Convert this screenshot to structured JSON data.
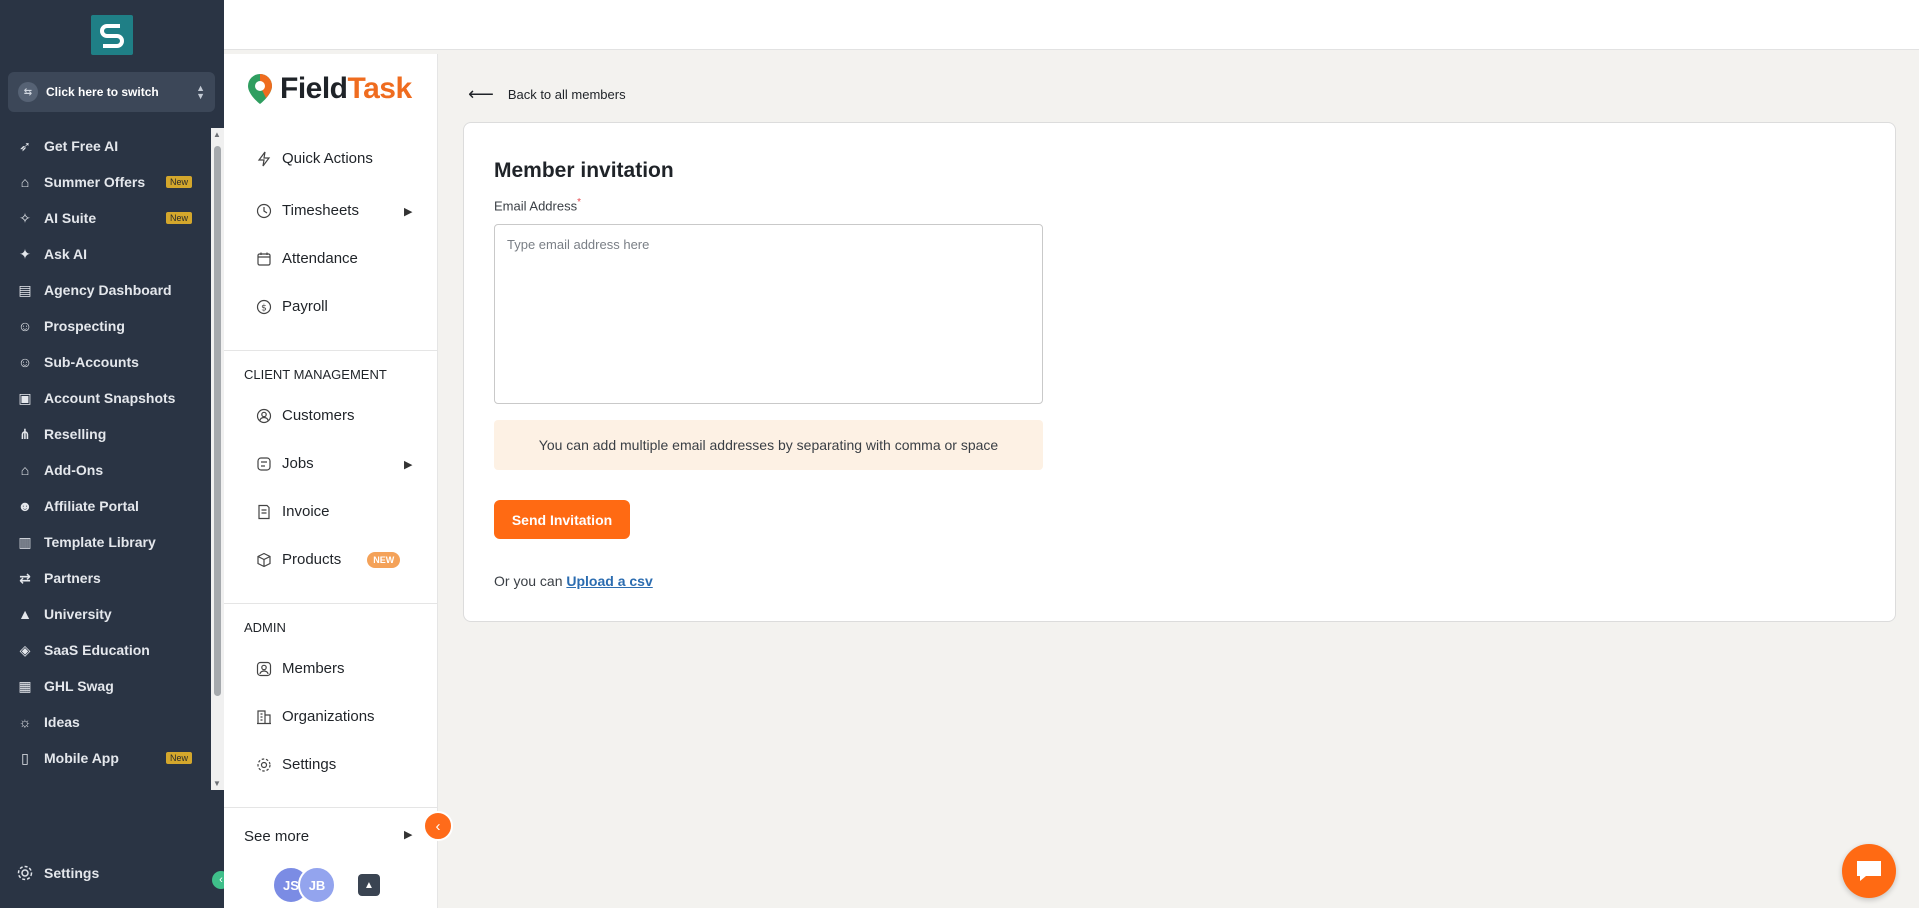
{
  "sidebar": {
    "switcher_label": "Click here to switch",
    "items": [
      {
        "label": "Get Free AI",
        "icon": "rocket-icon",
        "badge": ""
      },
      {
        "label": "Summer Offers",
        "icon": "gift-icon",
        "badge": "New"
      },
      {
        "label": "AI Suite",
        "icon": "sparkle-icon",
        "badge": "New"
      },
      {
        "label": "Ask AI",
        "icon": "stars-icon",
        "badge": ""
      },
      {
        "label": "Agency Dashboard",
        "icon": "dashboard-icon",
        "badge": ""
      },
      {
        "label": "Prospecting",
        "icon": "user-search-icon",
        "badge": ""
      },
      {
        "label": "Sub-Accounts",
        "icon": "user-icon",
        "badge": ""
      },
      {
        "label": "Account Snapshots",
        "icon": "snapshot-icon",
        "badge": ""
      },
      {
        "label": "Reselling",
        "icon": "network-icon",
        "badge": ""
      },
      {
        "label": "Add-Ons",
        "icon": "bag-icon",
        "badge": ""
      },
      {
        "label": "Affiliate Portal",
        "icon": "users-icon",
        "badge": ""
      },
      {
        "label": "Template Library",
        "icon": "library-icon",
        "badge": ""
      },
      {
        "label": "Partners",
        "icon": "handshake-icon",
        "badge": ""
      },
      {
        "label": "University",
        "icon": "graduation-icon",
        "badge": ""
      },
      {
        "label": "SaaS Education",
        "icon": "cube-icon",
        "badge": ""
      },
      {
        "label": "GHL Swag",
        "icon": "store-icon",
        "badge": ""
      },
      {
        "label": "Ideas",
        "icon": "bulb-icon",
        "badge": ""
      },
      {
        "label": "Mobile App",
        "icon": "phone-icon",
        "badge": "New"
      }
    ],
    "settings_label": "Settings"
  },
  "panel": {
    "brand_part1": "Field",
    "brand_part2": "Task",
    "quick_actions": "Quick Actions",
    "timesheets": "Timesheets",
    "attendance": "Attendance",
    "payroll": "Payroll",
    "client_management_heading": "CLIENT MANAGEMENT",
    "customers": "Customers",
    "jobs": "Jobs",
    "invoice": "Invoice",
    "products": "Products",
    "products_badge": "NEW",
    "admin_heading": "ADMIN",
    "members": "Members",
    "organizations": "Organizations",
    "settings": "Settings",
    "see_more": "See more",
    "avatar1": "JS",
    "avatar2": "JB"
  },
  "main": {
    "back_link": "Back to all members",
    "title": "Member invitation",
    "email_label": "Email Address",
    "required_mark": "*",
    "email_placeholder": "Type email address here",
    "hint": "You can add multiple email addresses by separating with comma or space",
    "send_button": "Send Invitation",
    "or_text": "Or you can",
    "upload_link": "Upload a csv"
  },
  "colors": {
    "accent": "#ff6a13",
    "sidebar_bg": "#2a3444",
    "badge": "#d4a72c",
    "link": "#2b6cb0"
  }
}
